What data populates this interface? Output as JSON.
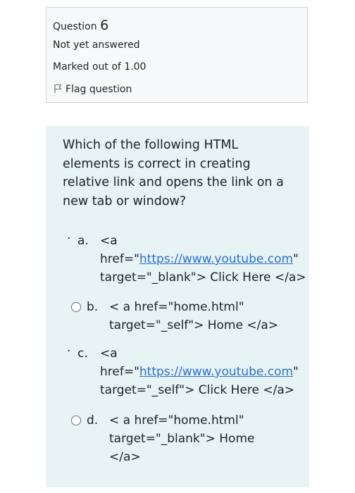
{
  "info": {
    "question_word": "Question",
    "question_number": "6",
    "state": "Not yet answered",
    "grade": "Marked out of 1.00",
    "flag_label": "Flag question",
    "flag_icon": "flag-icon"
  },
  "question": {
    "line1": "Which of the following HTML",
    "line2": "elements is correct in creating",
    "line3": "relative link and opens the link on a",
    "line4": "new tab or window?"
  },
  "answers": [
    {
      "letter": "a.",
      "marker": "·",
      "line1": "<a",
      "line2_prefix": "href=\"",
      "line2_link": "https://www.youtube.com",
      "line2_suffix": "\"",
      "line3": "target=\"_blank\"> Click Here </a>"
    },
    {
      "letter": "b.",
      "marker": "radio",
      "line1": "< a href=\"home.html\"",
      "line2": "target=\"_self\"> Home </a>"
    },
    {
      "letter": "c.",
      "marker": "·",
      "line1": "<a",
      "line2_prefix": "href=\"",
      "line2_link": "https://www.youtube.com",
      "line2_suffix": "\"",
      "line3": "target=\"_self\"> Click Here </a>"
    },
    {
      "letter": "d.",
      "marker": "radio",
      "line1": "< a href=\"home.html\"",
      "line2": "target=\"_blank\"> Home",
      "line3": "</a>"
    }
  ],
  "colors": {
    "panel_bg": "#e7f3f5",
    "info_bg": "#f8f9fa",
    "link": "#2a6fd6"
  }
}
